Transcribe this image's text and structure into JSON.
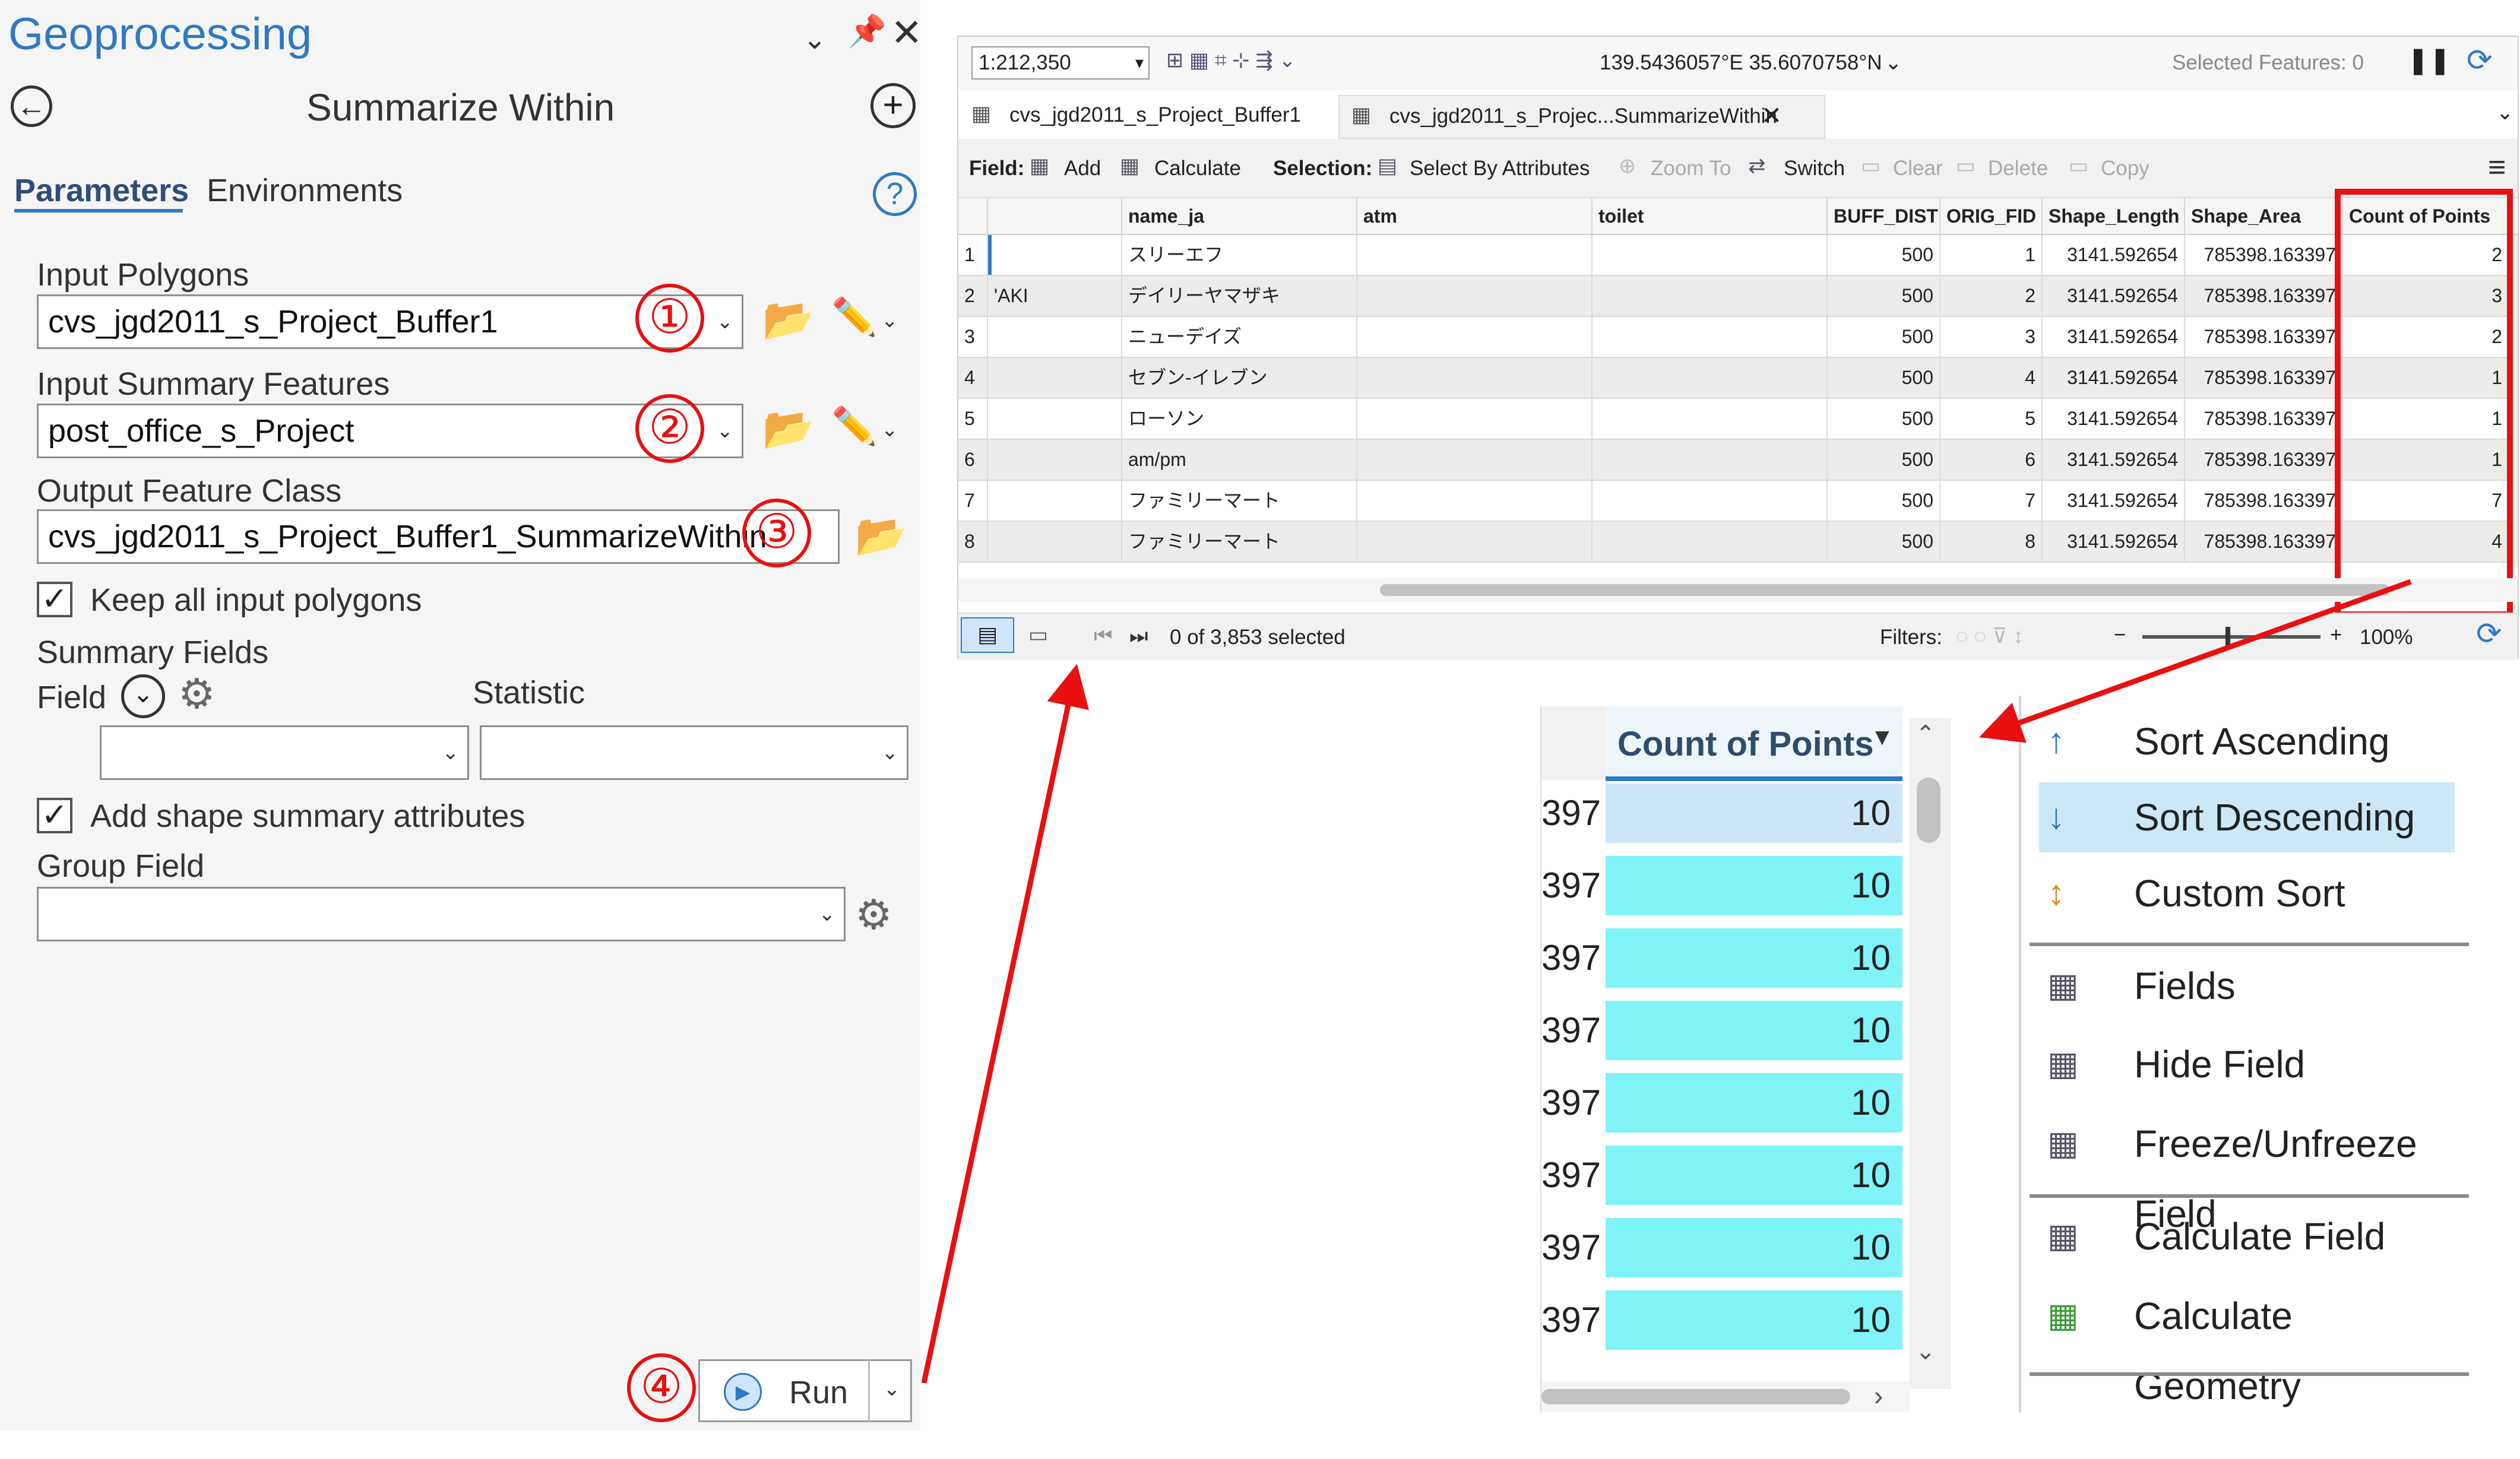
{
  "geoprocessing": {
    "pane_title": "Geoprocessing",
    "tool_title": "Summarize Within",
    "tabs": [
      "Parameters",
      "Environments"
    ],
    "input_polygons_label": "Input Polygons",
    "input_polygons_value": "cvs_jgd2011_s_Project_Buffer1",
    "input_summary_label": "Input Summary Features",
    "input_summary_value": "post_office_s_Project",
    "output_label": "Output Feature Class",
    "output_value": "cvs_jgd2011_s_Project_Buffer1_SummarizeWithin",
    "keep_label": "Keep all input polygons",
    "summary_fields_label": "Summary Fields",
    "field_label": "Field",
    "statistic_label": "Statistic",
    "shape_summary_label": "Add shape summary  attributes",
    "group_field_label": "Group Field",
    "run_label": "Run",
    "markers": [
      "①",
      "②",
      "③",
      "④"
    ]
  },
  "table": {
    "scale": "1:212,350",
    "coords": "139.5436057°E 35.6070758°N",
    "selected_features": "Selected Features: 0",
    "tabs": [
      "cvs_jgd2011_s_Project_Buffer1",
      "cvs_jgd2011_s_Projec...SummarizeWithin"
    ],
    "toolbar": {
      "field": "Field:",
      "add": "Add",
      "calculate": "Calculate",
      "selection": "Selection:",
      "select_by_attr": "Select By Attributes",
      "zoom_to": "Zoom To",
      "switch": "Switch",
      "clear": "Clear",
      "delete": "Delete",
      "copy": "Copy"
    },
    "columns": [
      "name_ja",
      "atm",
      "toilet",
      "BUFF_DIST",
      "ORIG_FID",
      "Shape_Length",
      "Shape_Area",
      "Count of Points"
    ],
    "rows": [
      {
        "n": "1",
        "pre": "",
        "name": "スリーエフ",
        "buff": "500",
        "fid": "1",
        "len": "3141.592654",
        "area": "785398.163397",
        "count": "2"
      },
      {
        "n": "2",
        "pre": "'AKI",
        "name": "デイリーヤマザキ",
        "buff": "500",
        "fid": "2",
        "len": "3141.592654",
        "area": "785398.163397",
        "count": "3"
      },
      {
        "n": "3",
        "pre": "",
        "name": "ニューデイズ",
        "buff": "500",
        "fid": "3",
        "len": "3141.592654",
        "area": "785398.163397",
        "count": "2"
      },
      {
        "n": "4",
        "pre": "",
        "name": "セブン-イレブン",
        "buff": "500",
        "fid": "4",
        "len": "3141.592654",
        "area": "785398.163397",
        "count": "1"
      },
      {
        "n": "5",
        "pre": "",
        "name": "ローソン",
        "buff": "500",
        "fid": "5",
        "len": "3141.592654",
        "area": "785398.163397",
        "count": "1"
      },
      {
        "n": "6",
        "pre": "",
        "name": "am/pm",
        "buff": "500",
        "fid": "6",
        "len": "3141.592654",
        "area": "785398.163397",
        "count": "1"
      },
      {
        "n": "7",
        "pre": "",
        "name": "ファミリーマート",
        "buff": "500",
        "fid": "7",
        "len": "3141.592654",
        "area": "785398.163397",
        "count": "7"
      },
      {
        "n": "8",
        "pre": "",
        "name": "ファミリーマート",
        "buff": "500",
        "fid": "8",
        "len": "3141.592654",
        "area": "785398.163397",
        "count": "4"
      }
    ],
    "status": "0 of 3,853 selected",
    "filters": "Filters:",
    "zoom_pct": "100%"
  },
  "zoom_inset": {
    "header": "Count of Points",
    "stub": "397",
    "values": [
      "10",
      "10",
      "10",
      "10",
      "10",
      "10",
      "10",
      "10"
    ]
  },
  "context_menu": {
    "items": [
      "Sort Ascending",
      "Sort Descending",
      "Custom Sort",
      "Fields",
      "Hide Field",
      "Freeze/Unfreeze Field",
      "Calculate Field",
      "Calculate Geometry"
    ]
  },
  "colors": {
    "accent": "#2f79c4",
    "highlight_cell": "#7ff3f7",
    "annotation": "#e81010",
    "menu_selected": "#cce8f6"
  }
}
